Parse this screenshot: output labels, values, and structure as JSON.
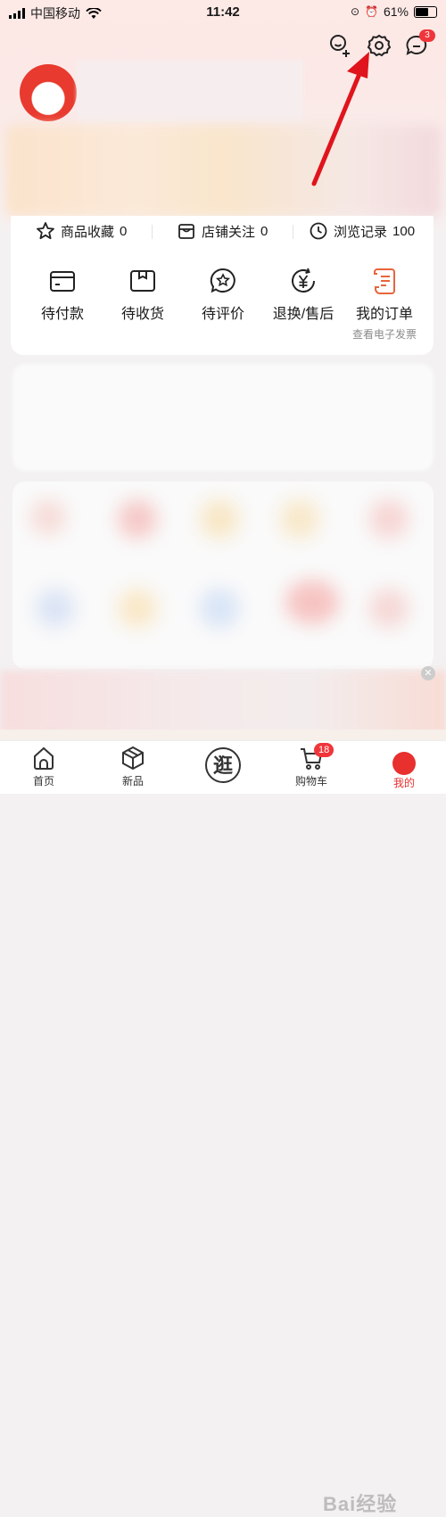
{
  "status_bar": {
    "carrier": "中国移动",
    "time": "11:42",
    "battery": "61%"
  },
  "header": {
    "message_badge": "3"
  },
  "stats": [
    {
      "label": "商品收藏",
      "count": "0"
    },
    {
      "label": "店铺关注",
      "count": "0"
    },
    {
      "label": "浏览记录",
      "count": "100"
    }
  ],
  "orders": [
    {
      "label": "待付款",
      "icon": "wallet-icon"
    },
    {
      "label": "待收货",
      "icon": "package-icon"
    },
    {
      "label": "待评价",
      "icon": "review-star-icon"
    },
    {
      "label": "退换/售后",
      "icon": "refund-yen-icon"
    },
    {
      "label": "我的订单",
      "icon": "order-list-icon",
      "sub": "查看电子发票"
    }
  ],
  "tabbar": [
    {
      "label": "首页",
      "icon": "home-icon"
    },
    {
      "label": "新品",
      "icon": "box-icon"
    },
    {
      "label": "逛",
      "icon": "explore-icon"
    },
    {
      "label": "购物车",
      "icon": "cart-icon",
      "badge": "18"
    },
    {
      "label": "我的",
      "icon": "profile-icon"
    }
  ],
  "watermark": "Bai经验",
  "colors": {
    "accent": "#f0353a",
    "arrow": "#e0141c"
  }
}
